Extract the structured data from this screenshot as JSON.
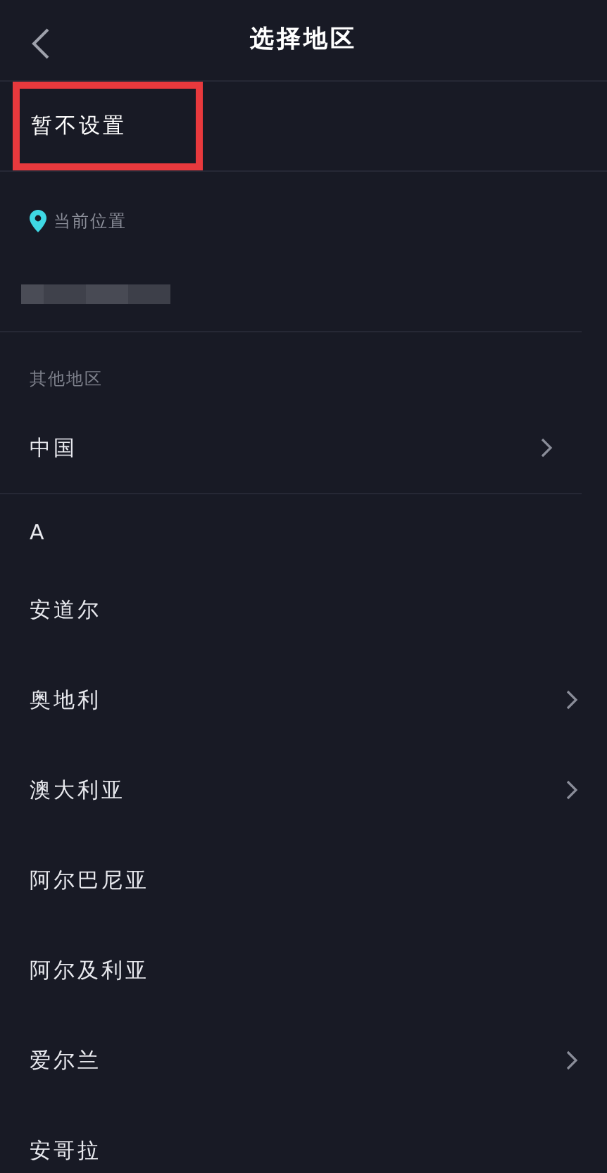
{
  "header": {
    "title": "选择地区"
  },
  "not_set": {
    "label": "暂不设置",
    "highlighted": true
  },
  "current_location": {
    "label": "当前位置",
    "redacted": true
  },
  "other_regions": {
    "heading": "其他地区",
    "items": [
      {
        "name": "中国",
        "has_children": true
      }
    ]
  },
  "sections": [
    {
      "letter": "A",
      "items": [
        {
          "name": "安道尔",
          "has_children": false
        },
        {
          "name": "奥地利",
          "has_children": true
        },
        {
          "name": "澳大利亚",
          "has_children": true
        },
        {
          "name": "阿尔巴尼亚",
          "has_children": false
        },
        {
          "name": "阿尔及利亚",
          "has_children": false
        },
        {
          "name": "爱尔兰",
          "has_children": true
        },
        {
          "name": "安哥拉",
          "has_children": false
        }
      ]
    }
  ]
}
